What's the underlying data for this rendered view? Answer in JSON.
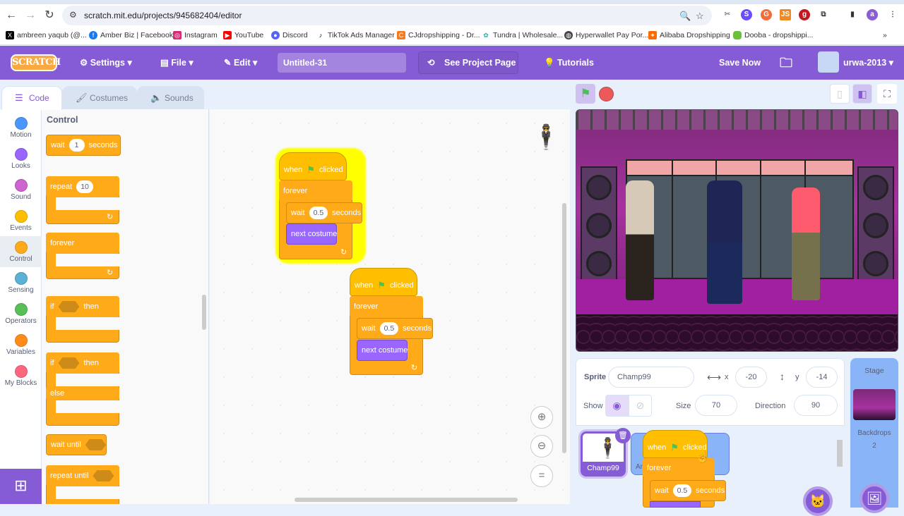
{
  "browser": {
    "url": "scratch.mit.edu/projects/945682404/editor",
    "bookmarks": [
      {
        "label": "ambreen yaqub (@...",
        "icon": "x-icon",
        "color": "#000000"
      },
      {
        "label": "Amber Biz | Facebook",
        "icon": "facebook-icon",
        "color": "#1877f2"
      },
      {
        "label": "Instagram",
        "icon": "instagram-icon",
        "color": "#d62976"
      },
      {
        "label": "YouTube",
        "icon": "youtube-icon",
        "color": "#ff0000"
      },
      {
        "label": "Discord",
        "icon": "discord-icon",
        "color": "#5865f2"
      },
      {
        "label": "TikTok Ads Manager",
        "icon": "tiktok-icon",
        "color": "#000000"
      },
      {
        "label": "CJdropshipping - Dr...",
        "icon": "cj-icon",
        "color": "#f47b20"
      },
      {
        "label": "Tundra | Wholesale...",
        "icon": "tundra-icon",
        "color": "#2bb3a3"
      },
      {
        "label": "Hyperwallet Pay Por...",
        "icon": "globe-icon",
        "color": "#444444"
      },
      {
        "label": "Alibaba Dropshipping",
        "icon": "alibaba-icon",
        "color": "#ff6a00"
      },
      {
        "label": "Dooba - dropshippi...",
        "icon": "dooba-icon",
        "color": "#6abf3b"
      }
    ],
    "more_bookmarks": "»",
    "profile_initial": "a"
  },
  "menu": {
    "logo": "SCRATCH",
    "settings": "Settings",
    "file": "File",
    "edit": "Edit",
    "project_title": "Untitled-31",
    "see_project_page": "See Project Page",
    "tutorials": "Tutorials",
    "save_now": "Save Now",
    "username": "urwa-2013"
  },
  "tabs": {
    "code": "Code",
    "costumes": "Costumes",
    "sounds": "Sounds"
  },
  "categories": [
    {
      "label": "Motion",
      "color": "#4c97ff"
    },
    {
      "label": "Looks",
      "color": "#9966ff"
    },
    {
      "label": "Sound",
      "color": "#cf63cf"
    },
    {
      "label": "Events",
      "color": "#ffbf00"
    },
    {
      "label": "Control",
      "color": "#ffab19"
    },
    {
      "label": "Sensing",
      "color": "#5cb1d6"
    },
    {
      "label": "Operators",
      "color": "#59c059"
    },
    {
      "label": "Variables",
      "color": "#ff8c1a"
    },
    {
      "label": "My Blocks",
      "color": "#ff6680"
    }
  ],
  "palette": {
    "title": "Control",
    "wait": {
      "label": "wait",
      "value": "1",
      "suffix": "seconds"
    },
    "repeat": {
      "label": "repeat",
      "value": "10"
    },
    "forever": "forever",
    "if_then": {
      "if": "if",
      "then": "then"
    },
    "if_else": {
      "if": "if",
      "then": "then",
      "else": "else"
    },
    "wait_until": "wait until",
    "repeat_until": "repeat until"
  },
  "scripts": [
    {
      "hat": "when",
      "hat_suffix": "clicked",
      "loop": "forever",
      "wait": "wait",
      "wait_value": "0.5",
      "wait_suffix": "seconds",
      "looks": "next costume",
      "highlighted": true
    },
    {
      "hat": "when",
      "hat_suffix": "clicked",
      "loop": "forever",
      "wait": "wait",
      "wait_value": "0.5",
      "wait_suffix": "seconds",
      "looks": "next costume",
      "highlighted": false
    }
  ],
  "dragging": {
    "hat": "when",
    "hat_suffix": "clicked",
    "loop": "forever",
    "wait": "wait",
    "wait_value": "0.5",
    "wait_suffix": "seconds"
  },
  "sprite_info": {
    "sprite_label": "Sprite",
    "sprite_name": "Champ99",
    "x_label": "x",
    "x": "-20",
    "y_label": "y",
    "y": "-14",
    "show_label": "Show",
    "size_label": "Size",
    "size": "70",
    "direction_label": "Direction",
    "direction": "90"
  },
  "sprites": [
    {
      "name": "Champ99",
      "selected": true
    },
    {
      "name": "Ar...",
      "selected": false
    }
  ],
  "stage_panel": {
    "title": "Stage",
    "backdrops_label": "Backdrops",
    "backdrops_count": "2"
  },
  "colors": {
    "scratch_purple": "#855cd6",
    "control": "#ffab19",
    "events": "#ffbf00",
    "looks": "#9966ff",
    "highlight": "#ffff00"
  }
}
